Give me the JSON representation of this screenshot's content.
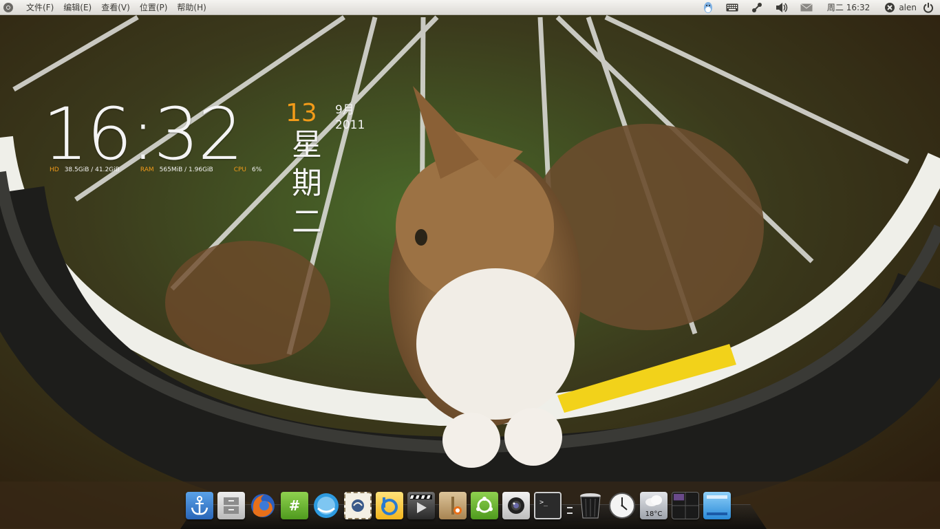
{
  "top_panel": {
    "menus": [
      "文件(F)",
      "编辑(E)",
      "查看(V)",
      "位置(P)",
      "帮助(H)"
    ],
    "icons": [
      "ubuntu-logo-icon",
      "qq-icon",
      "keyboard-icon",
      "network-icon",
      "volume-icon",
      "mail-icon",
      "session-icon",
      "power-icon"
    ],
    "clock": "周二 16:32",
    "user": "alen"
  },
  "conky": {
    "time": "16:32",
    "day": "13",
    "month_year": "9月 2011",
    "weekday": "星期二",
    "stats": [
      {
        "label": "HD",
        "value": "38.5GiB / 41.2GiB"
      },
      {
        "label": "RAM",
        "value": "565MiB / 1.96GiB"
      },
      {
        "label": "CPU",
        "value": "6%"
      }
    ],
    "accent_color": "#f29b19"
  },
  "dock": {
    "items": [
      {
        "name": "anchor-icon"
      },
      {
        "name": "file-manager-icon"
      },
      {
        "name": "firefox-icon"
      },
      {
        "name": "chat-hash-icon"
      },
      {
        "name": "qq-penguin-icon"
      },
      {
        "name": "mail-stamp-icon"
      },
      {
        "name": "bookmark-b-icon"
      },
      {
        "name": "video-player-icon"
      },
      {
        "name": "package-installer-icon"
      },
      {
        "name": "software-center-icon"
      },
      {
        "name": "camera-icon"
      },
      {
        "name": "terminal-icon"
      },
      {
        "name": "trash-icon"
      },
      {
        "name": "clock-icon"
      },
      {
        "name": "weather-icon",
        "label": "18°C"
      },
      {
        "name": "workspace-switcher-icon"
      },
      {
        "name": "show-desktop-icon"
      }
    ]
  }
}
